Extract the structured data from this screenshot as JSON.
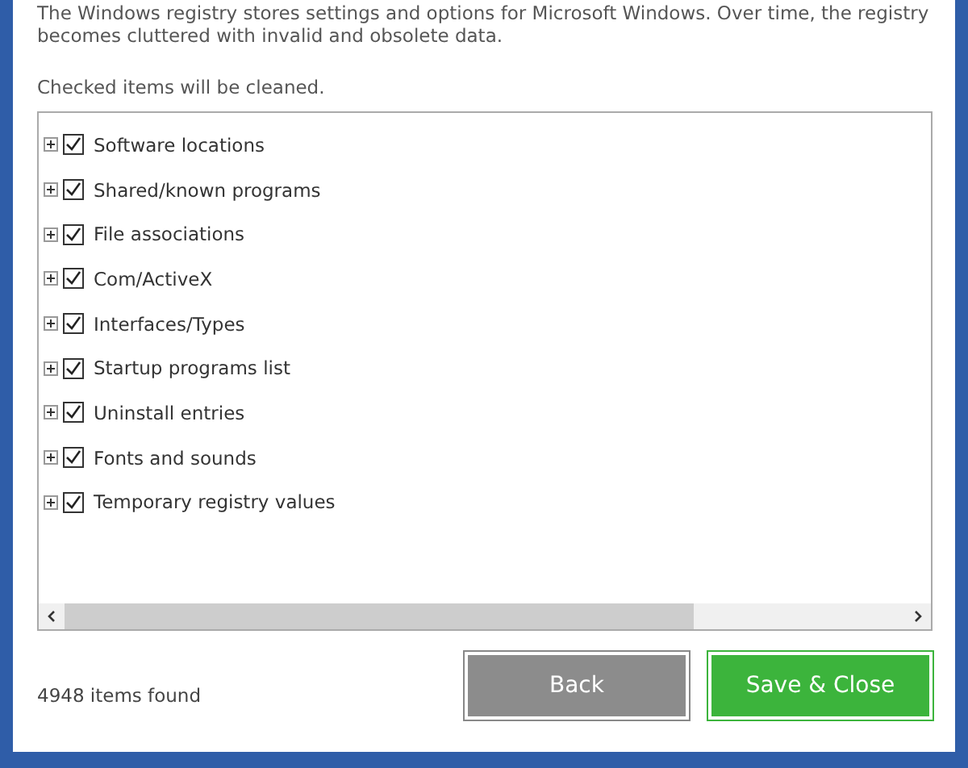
{
  "description": "The Windows registry stores settings and options for Microsoft Windows. Over time, the registry becomes cluttered with invalid and obsolete data.",
  "hint": "Checked items will be cleaned.",
  "items": [
    {
      "label": "Software locations",
      "checked": true,
      "expanded": false
    },
    {
      "label": "Shared/known programs",
      "checked": true,
      "expanded": false
    },
    {
      "label": "File associations",
      "checked": true,
      "expanded": false
    },
    {
      "label": "Com/ActiveX",
      "checked": true,
      "expanded": false
    },
    {
      "label": "Interfaces/Types",
      "checked": true,
      "expanded": false
    },
    {
      "label": "Startup programs list",
      "checked": true,
      "expanded": false
    },
    {
      "label": "Uninstall entries",
      "checked": true,
      "expanded": false
    },
    {
      "label": "Fonts and sounds",
      "checked": true,
      "expanded": false
    },
    {
      "label": "Temporary registry values",
      "checked": true,
      "expanded": false
    }
  ],
  "status": "4948 items found",
  "buttons": [
    {
      "label": "Back",
      "kind": "secondary"
    },
    {
      "label": "Save & Close",
      "kind": "primary"
    }
  ]
}
